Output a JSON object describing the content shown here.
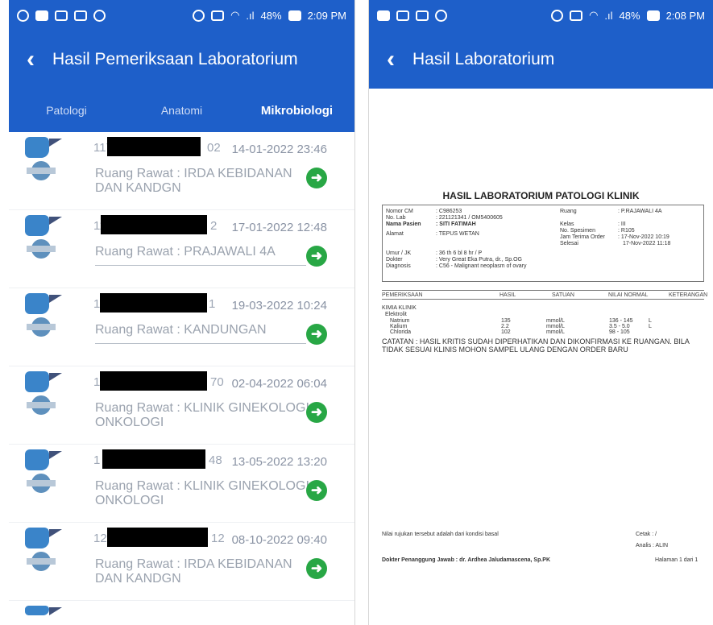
{
  "left": {
    "status": {
      "time": "2:09 PM",
      "battery": "48%"
    },
    "title": "Hasil Pemeriksaan Laboratorium",
    "tabs": [
      "Patologi",
      "Anatomi",
      "Mikrobiologi"
    ],
    "records": [
      {
        "id_prefix": "117",
        "id_suffix": "02",
        "date": "14-01-2022 23:46",
        "room": "Ruang Rawat : IRDA KEBIDANAN DAN KANDGN"
      },
      {
        "id_prefix": "11",
        "id_suffix": "2",
        "date": "17-01-2022 12:48",
        "room": "Ruang Rawat : PRAJAWALI 4A"
      },
      {
        "id_prefix": "1",
        "id_suffix": "1",
        "date": "19-03-2022 10:24",
        "room": "Ruang Rawat : KANDUNGAN"
      },
      {
        "id_prefix": "1",
        "id_suffix": "70",
        "date": "02-04-2022 06:04",
        "room": "Ruang Rawat : KLINIK GINEKOLOGI ONKOLOGI"
      },
      {
        "id_prefix": "1",
        "id_suffix": "48",
        "date": "13-05-2022 13:20",
        "room": "Ruang Rawat : KLINIK GINEKOLOGI ONKOLOGI"
      },
      {
        "id_prefix": "12",
        "id_suffix": "12",
        "date": "08-10-2022 09:40",
        "room": "Ruang Rawat : IRDA KEBIDANAN DAN KANDGN"
      }
    ]
  },
  "right": {
    "status": {
      "time": "2:08 PM",
      "battery": "48%"
    },
    "title": "Hasil Laboratorium",
    "report": {
      "heading": "HASIL LABORATORIUM PATOLOGI KLINIK",
      "labels1": [
        "Nomor CM",
        "No. Lab",
        "Nama Pasien",
        "Alamat",
        "Umur / JK",
        "Dokter",
        "Diagnosis"
      ],
      "values1": [
        ": C986253",
        ": 221121341 / OM5400605",
        ": SITI FATIMAH",
        ": TEPUS WETAN",
        ": 36 th 6 bl 8 hr / P",
        ": Very Great Eka Putra, dr., Sp.OG",
        ": C56 - Malignant neoplasm of ovary"
      ],
      "labels2": [
        "Ruang",
        "Kelas",
        "No. Spesimen",
        "Jam Terima Order",
        "Selesai"
      ],
      "values2": [
        ": P.RAJAWALI 4A",
        ": III",
        ": R105",
        ": 17-Nov-2022 10:19",
        "17-Nov-2022 11:18"
      ],
      "columns": [
        "PEMERIKSAAN",
        "HASIL",
        "SATUAN",
        "NILAI NORMAL",
        "KETERANGAN"
      ],
      "section": "KIMIA KLINIK",
      "subsection": "Elektrolit",
      "rows": [
        {
          "test": "Natrium",
          "result": "135",
          "unit": "mmol/L",
          "normal": "136 - 145",
          "note": "L"
        },
        {
          "test": "Kalium",
          "result": "2.2",
          "unit": "mmol/L",
          "normal": "3.5 - 5.0",
          "note": "L"
        },
        {
          "test": "Chlorida",
          "result": "102",
          "unit": "mmol/L",
          "normal": "98 - 105",
          "note": ""
        }
      ],
      "catatan_label": "CATATAN :",
      "catatan": "HASIL KRITIS SUDAH DIPERHATIKAN DAN DIKONFIRMASI KE RUANGAN. BILA TIDAK SESUAI KLINIS MOHON SAMPEL ULANG DENGAN ORDER BARU",
      "footer_note": "Nilai rujukan tersebut adalah dari kondisi basal",
      "cetak": "Cetak : /",
      "analis": "Analis : ALIN",
      "doctor": "Dokter Penanggung Jawab : dr. Ardhea Jaludamascena, Sp.PK",
      "page": "Halaman 1 dari 1"
    }
  }
}
